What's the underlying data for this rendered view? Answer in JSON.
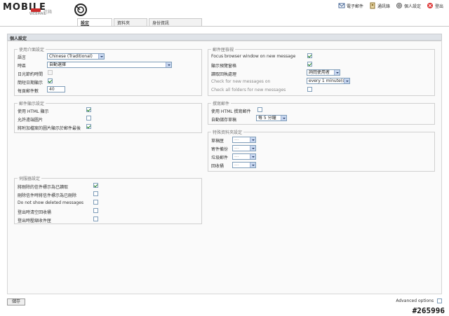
{
  "header": {
    "logo_text": "MOBILE",
    "logo_sub": "WEBMAIL",
    "logo_tag": "信箱",
    "links": [
      {
        "label": "電子郵件",
        "icon": "mail-icon"
      },
      {
        "label": "通訊錄",
        "icon": "address-book-icon"
      },
      {
        "label": "個人設定",
        "icon": "settings-icon"
      },
      {
        "label": "登出",
        "icon": "logout-icon"
      }
    ]
  },
  "tabs": [
    {
      "label": "設定",
      "active": true
    },
    {
      "label": "資料夾",
      "active": false
    },
    {
      "label": "身份資訊",
      "active": false
    }
  ],
  "section_title": "個人設定",
  "ui": {
    "legend": "使用介面設定",
    "language_label": "語言",
    "language_value": "Chinese (Traditional)",
    "timezone_label": "時區",
    "timezone_value": "自動選擇",
    "dst_label": "日光節約時間",
    "pretty_date_label": "簡短日期顯示",
    "rows_label": "每頁郵件數",
    "rows_value": "40"
  },
  "mailbox_view": {
    "legend": "郵件匣檢視",
    "focus_label": "Focus browser window on new message",
    "preview_label": "顯示預覽窗格",
    "read_when_label": "讀取回執處理",
    "read_when_value": "詢問使用者",
    "check_new_label": "Check for new messages on",
    "check_new_value": "every 1 minute(s)",
    "check_all_label": "Check all folders for new messages"
  },
  "display": {
    "legend": "郵件顯示設定",
    "html_label": "使用 HTML 顯示",
    "remote_img_label": "允許遠端圖片",
    "inline_img_label": "將附加檔案的圖片顯示於郵件最後"
  },
  "compose": {
    "legend": "撰寫郵件",
    "html_label": "使用 HTML 撰寫郵件",
    "draft_label": "自動儲存草稿",
    "draft_value": "每 5 分鐘"
  },
  "special_folders": {
    "legend": "特殊資料夾設定",
    "items": [
      {
        "label": "草稿匣",
        "value": "---"
      },
      {
        "label": "寄件備份",
        "value": "---"
      },
      {
        "label": "垃圾郵件",
        "value": "---"
      },
      {
        "label": "回收桶",
        "value": "---"
      }
    ]
  },
  "server": {
    "legend": "伺服器設定",
    "items": [
      {
        "label": "將刪除的信件標示為已讀取",
        "checked": true
      },
      {
        "label": "刪除信件時將信件標示為已刪除",
        "checked": false
      },
      {
        "label": "Do not show deleted messages",
        "checked": false
      },
      {
        "label": "登出時清空回收桶",
        "checked": false
      },
      {
        "label": "登出時壓縮收件匣",
        "checked": false
      }
    ]
  },
  "footer": {
    "save_label": "儲存",
    "advanced_label": "Advanced options",
    "watermark": "#265996"
  }
}
